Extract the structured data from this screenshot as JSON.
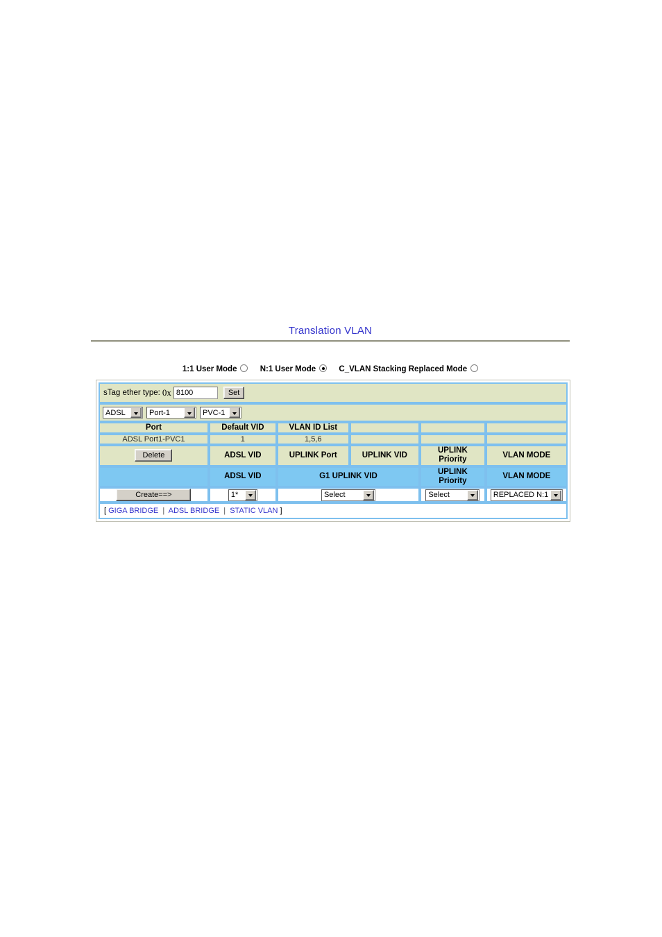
{
  "page": {
    "title": "Translation VLAN",
    "title_color": "#3333cc"
  },
  "modes": [
    {
      "label": "1:1 User Mode",
      "selected": false
    },
    {
      "label": "N:1 User Mode",
      "selected": true
    },
    {
      "label": "C_VLAN Stacking Replaced Mode",
      "selected": false
    }
  ],
  "stag": {
    "label": "sTag ether type:",
    "prefix": "0x",
    "value": "8100",
    "set_button": "Set"
  },
  "selectors": [
    {
      "name": "interface-type",
      "value": "ADSL"
    },
    {
      "name": "port",
      "value": "Port-1"
    },
    {
      "name": "pvc",
      "value": "PVC-1"
    }
  ],
  "port_table": {
    "headers": [
      "Port",
      "Default VID",
      "VLAN ID List",
      "",
      "",
      ""
    ],
    "rows": [
      [
        "ADSL Port1-PVC1",
        "1",
        "1,5,6",
        "",
        "",
        ""
      ]
    ]
  },
  "entry_header": {
    "delete_button": "Delete",
    "columns": [
      "ADSL VID",
      "UPLINK Port",
      "UPLINK VID",
      "UPLINK\nPriority",
      "VLAN MODE"
    ],
    "col_adsl_vid": "ADSL VID",
    "col_uplink_port": "UPLINK Port",
    "col_uplink_vid": "UPLINK VID",
    "col_uplink_priority_l1": "UPLINK",
    "col_uplink_priority_l2": "Priority",
    "col_vlan_mode": "VLAN MODE"
  },
  "create_header": {
    "col_adsl_vid": "ADSL VID",
    "col_g1_uplink_vid": "G1 UPLINK VID",
    "col_uplink_priority_l1": "UPLINK",
    "col_uplink_priority_l2": "Priority",
    "col_vlan_mode": "VLAN MODE",
    "bg_color": "#7ec8f2"
  },
  "create_row": {
    "create_button": "Create==>",
    "adsl_vid": "1*",
    "g1_uplink_vid": "Select",
    "uplink_priority": "Select",
    "vlan_mode": "REPLACED N:1"
  },
  "links": {
    "open_bracket": "[",
    "close_bracket": "]",
    "separator": "|",
    "items": [
      {
        "label": "GIGA BRIDGE"
      },
      {
        "label": "ADSL BRIDGE"
      },
      {
        "label": "STATIC VLAN"
      }
    ]
  },
  "colors": {
    "beige": "#e0e5c4",
    "blue": "#7ec8f2",
    "cell_border": "#7ec0ee",
    "link": "#3333cc"
  }
}
